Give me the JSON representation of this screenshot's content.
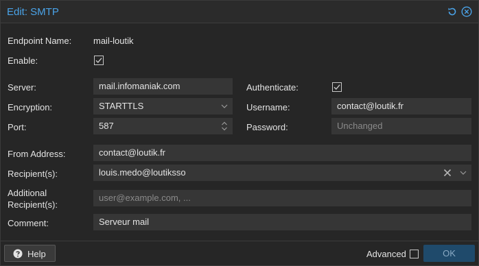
{
  "window": {
    "title": "Edit: SMTP",
    "accent_color": "#4aa3e8",
    "icons": [
      "reset-icon",
      "close-icon"
    ]
  },
  "form": {
    "endpoint_name": {
      "label": "Endpoint Name:",
      "value": "mail-loutik"
    },
    "enable": {
      "label": "Enable:",
      "checked": true
    },
    "server": {
      "label": "Server:",
      "value": "mail.infomaniak.com"
    },
    "encryption": {
      "label": "Encryption:",
      "value": "STARTTLS"
    },
    "port": {
      "label": "Port:",
      "value": "587"
    },
    "authenticate": {
      "label": "Authenticate:",
      "checked": true
    },
    "username": {
      "label": "Username:",
      "value": "contact@loutik.fr"
    },
    "password": {
      "label": "Password:",
      "placeholder": "Unchanged"
    },
    "from_address": {
      "label": "From Address:",
      "value": "contact@loutik.fr"
    },
    "recipients": {
      "label": "Recipient(s):",
      "value": "louis.medo@loutiksso"
    },
    "additional_recipients": {
      "label_line1": "Additional",
      "label_line2": "Recipient(s):",
      "placeholder": "user@example.com, ..."
    },
    "comment": {
      "label": "Comment:",
      "value": "Serveur mail"
    }
  },
  "footer": {
    "help_label": "Help",
    "advanced_label": "Advanced",
    "advanced_checked": false,
    "ok_label": "OK"
  }
}
